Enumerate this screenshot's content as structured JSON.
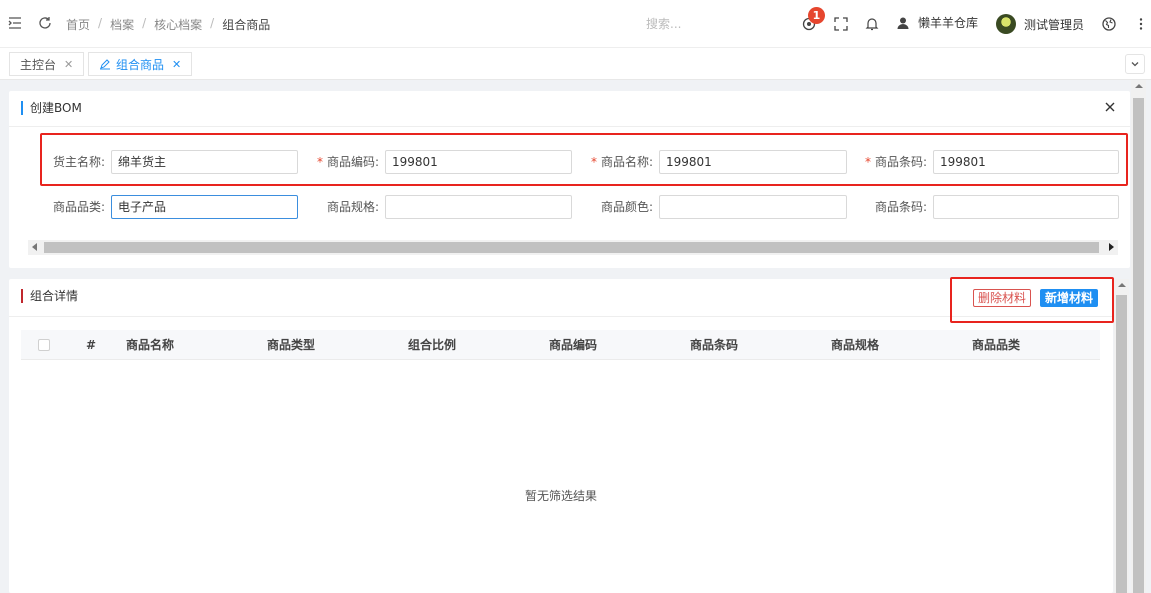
{
  "header": {
    "breadcrumb": [
      "首页",
      "档案",
      "核心档案",
      "组合商品"
    ],
    "search_placeholder": "搜索...",
    "notification_count": "1",
    "warehouse": "懒羊羊仓库",
    "user": "测试管理员"
  },
  "tabs": [
    {
      "label": "主控台"
    },
    {
      "label": "组合商品"
    }
  ],
  "bom": {
    "title": "创建BOM",
    "fields_row1": [
      {
        "label": "货主名称:",
        "value": "绵羊货主",
        "required": false
      },
      {
        "label": "商品编码:",
        "value": "199801",
        "required": true
      },
      {
        "label": "商品名称:",
        "value": "199801",
        "required": true
      },
      {
        "label": "商品条码:",
        "value": "199801",
        "required": true
      }
    ],
    "fields_row2": [
      {
        "label": "商品品类:",
        "value": "电子产品",
        "required": false
      },
      {
        "label": "商品规格:",
        "value": "",
        "required": false
      },
      {
        "label": "商品颜色:",
        "value": "",
        "required": false
      },
      {
        "label": "商品条码:",
        "value": "",
        "required": false
      }
    ],
    "required_mark": "*"
  },
  "detail": {
    "title": "组合详情",
    "delete_label": "删除材料",
    "add_label": "新增材料",
    "columns": [
      "#",
      "商品名称",
      "商品类型",
      "组合比例",
      "商品编码",
      "商品条码",
      "商品规格",
      "商品品类"
    ],
    "empty_text": "暂无筛选结果"
  },
  "colors": {
    "accent": "#1f8ff2",
    "danger": "#e6462e",
    "highlight": "#e8241e"
  }
}
